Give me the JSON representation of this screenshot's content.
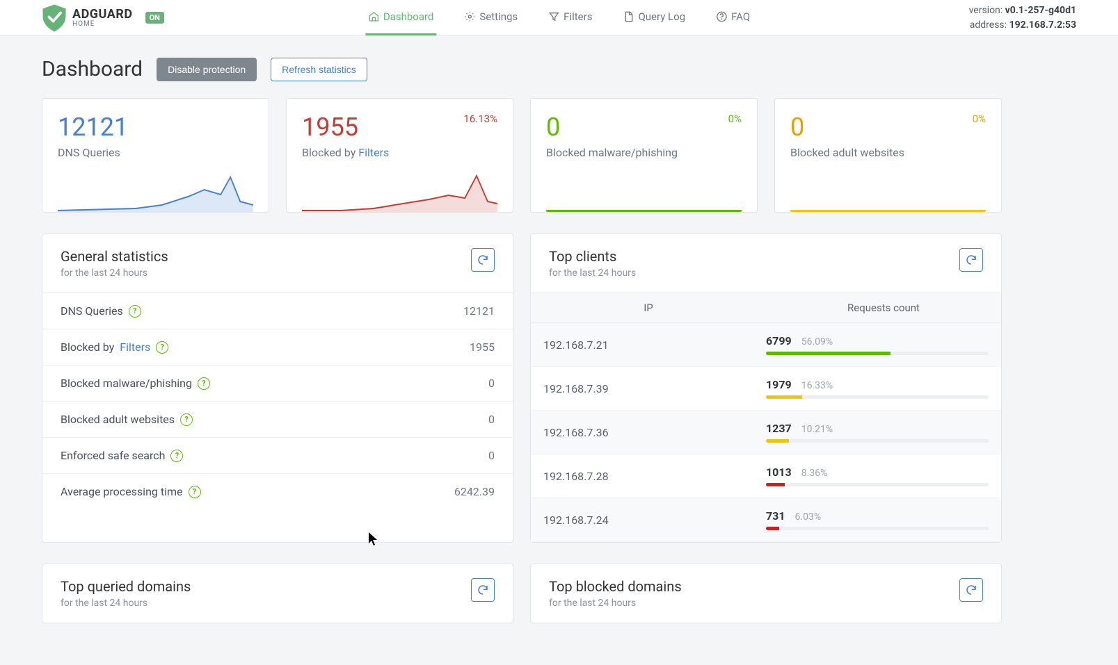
{
  "brand": {
    "name": "ADGUARD",
    "sub": "HOME",
    "status_badge": "ON"
  },
  "nav": {
    "items": [
      {
        "label": "Dashboard",
        "icon": "home-icon",
        "active": true
      },
      {
        "label": "Settings",
        "icon": "gear-icon",
        "active": false
      },
      {
        "label": "Filters",
        "icon": "filter-icon",
        "active": false
      },
      {
        "label": "Query Log",
        "icon": "file-icon",
        "active": false
      },
      {
        "label": "FAQ",
        "icon": "help-icon",
        "active": false
      }
    ],
    "meta": {
      "version_label": "version:",
      "version_value": "v0.1-257-g40d1",
      "address_label": "address:",
      "address_value": "192.168.7.2:53"
    }
  },
  "page": {
    "title": "Dashboard",
    "disable_btn": "Disable protection",
    "refresh_btn": "Refresh statistics"
  },
  "stats": [
    {
      "value": "12121",
      "pct": "",
      "label_prefix": "DNS Queries",
      "label_link": "",
      "label_suffix": "",
      "color": "blue",
      "spark": true,
      "spark_color": "#467fcf",
      "spark_fill": "#dce8f6"
    },
    {
      "value": "1955",
      "pct": "16.13%",
      "label_prefix": "Blocked by ",
      "label_link": "Filters",
      "label_suffix": "",
      "color": "red",
      "spark": true,
      "spark_color": "#c23d33",
      "spark_fill": "#f4dcdb"
    },
    {
      "value": "0",
      "pct": "0%",
      "label_prefix": "Blocked malware/phishing",
      "label_link": "",
      "label_suffix": "",
      "color": "green",
      "spark": false,
      "base_color": "#5eba00"
    },
    {
      "value": "0",
      "pct": "0%",
      "label_prefix": "Blocked adult websites",
      "label_link": "",
      "label_suffix": "",
      "color": "yellow",
      "spark": false,
      "base_color": "#f1c40f"
    }
  ],
  "general": {
    "title": "General statistics",
    "subtitle": "for the last 24 hours",
    "rows": [
      {
        "label": "DNS Queries",
        "link": "",
        "value": "12121"
      },
      {
        "label": "Blocked by ",
        "link": "Filters",
        "value": "1955"
      },
      {
        "label": "Blocked malware/phishing",
        "link": "",
        "value": "0"
      },
      {
        "label": "Blocked adult websites",
        "link": "",
        "value": "0"
      },
      {
        "label": "Enforced safe search",
        "link": "",
        "value": "0"
      },
      {
        "label": "Average processing time",
        "link": "",
        "value": "6242.39"
      }
    ]
  },
  "top_clients": {
    "title": "Top clients",
    "subtitle": "for the last 24 hours",
    "col1": "IP",
    "col2": "Requests count",
    "rows": [
      {
        "ip": "192.168.7.21",
        "count": "6799",
        "pct": "56.09%",
        "bar_pct": 56.09,
        "bar_class": "bar-green",
        "alt": true
      },
      {
        "ip": "192.168.7.39",
        "count": "1979",
        "pct": "16.33%",
        "bar_pct": 16.33,
        "bar_class": "bar-yellow",
        "alt": false
      },
      {
        "ip": "192.168.7.36",
        "count": "1237",
        "pct": "10.21%",
        "bar_pct": 10.21,
        "bar_class": "bar-yellow",
        "alt": true
      },
      {
        "ip": "192.168.7.28",
        "count": "1013",
        "pct": "8.36%",
        "bar_pct": 8.36,
        "bar_class": "bar-red",
        "alt": false
      },
      {
        "ip": "192.168.7.24",
        "count": "731",
        "pct": "6.03%",
        "bar_pct": 6.03,
        "bar_class": "bar-red",
        "alt": true
      }
    ]
  },
  "top_queried": {
    "title": "Top queried domains",
    "subtitle": "for the last 24 hours"
  },
  "top_blocked": {
    "title": "Top blocked domains",
    "subtitle": "for the last 24 hours"
  }
}
